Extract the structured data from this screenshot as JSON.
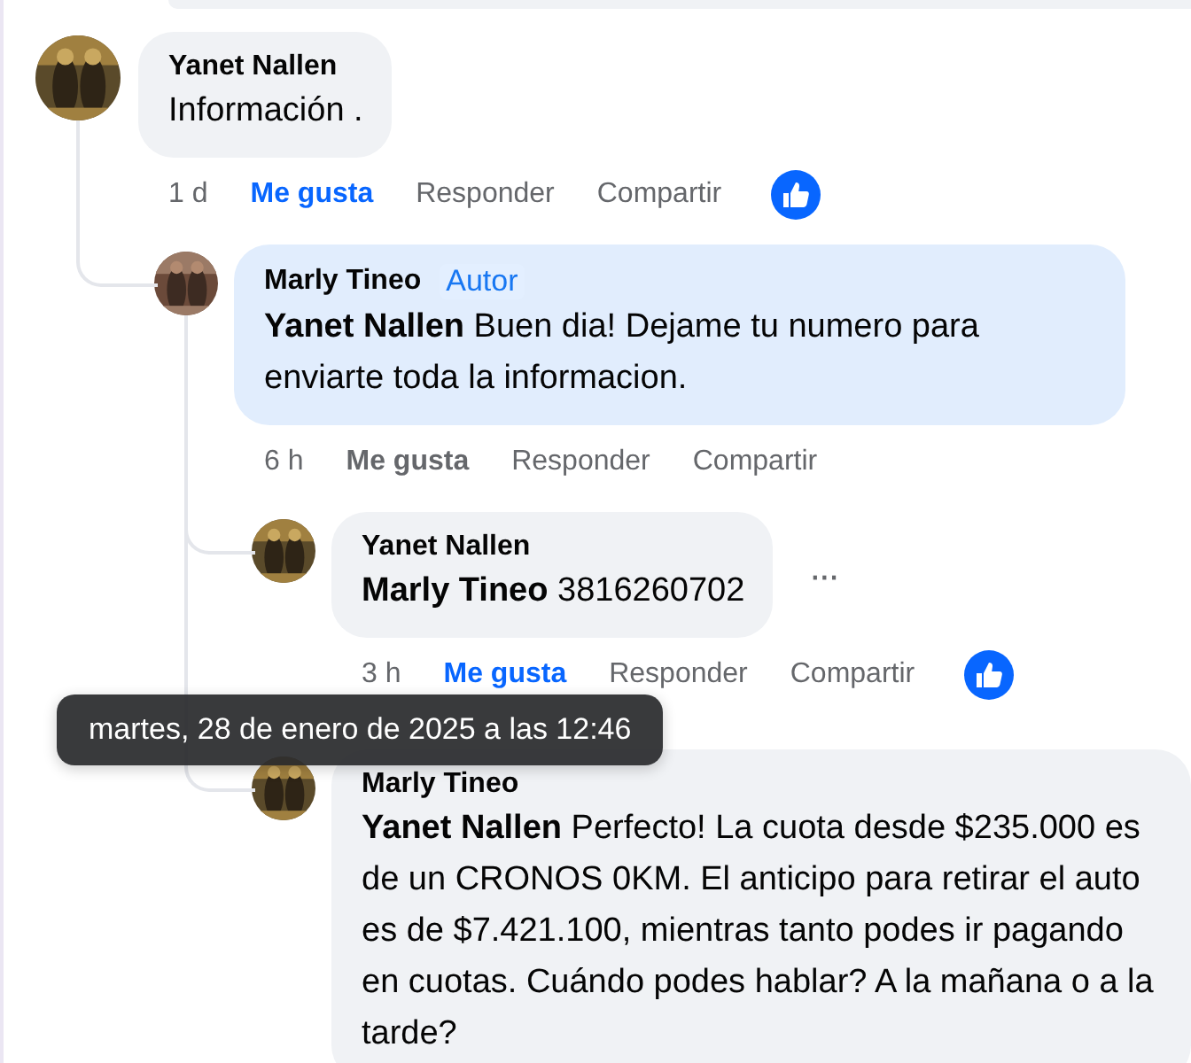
{
  "comments": [
    {
      "author": "Yanet Nallen",
      "text": "Información .",
      "time": "1 d",
      "like": {
        "label": "Me gusta",
        "selected": true
      },
      "reply": "Responder",
      "share": "Compartir",
      "reacted": true,
      "children": [
        {
          "author": "Marly Tineo",
          "badge": "Autor",
          "author_side": true,
          "mention": "Yanet Nallen",
          "text": "Buen dia! Dejame tu numero para enviarte toda la informacion.",
          "time": "6 h",
          "like": {
            "label": "Me gusta",
            "selected": false
          },
          "reply": "Responder",
          "share": "Compartir",
          "reacted": false,
          "children": [
            {
              "author": "Yanet Nallen",
              "mention": "Marly Tineo",
              "text": "3816260702",
              "time": "3 h",
              "like": {
                "label": "Me gusta",
                "selected": true
              },
              "reply": "Responder",
              "share": "Compartir",
              "reacted": true,
              "more": "···"
            },
            {
              "author": "Marly Tineo",
              "mention": "Yanet Nallen",
              "text": "Perfecto! La cuota desde $235.000 es de un CRONOS 0KM. El anticipo para retirar el auto es de $7.421.100, mientras tanto podes ir pagando en cuotas. Cuándo podes hablar? A la mañana o a la tarde?"
            }
          ]
        }
      ]
    }
  ],
  "tooltip": {
    "text": "martes, 28 de enero de 2025 a las 12:46"
  }
}
